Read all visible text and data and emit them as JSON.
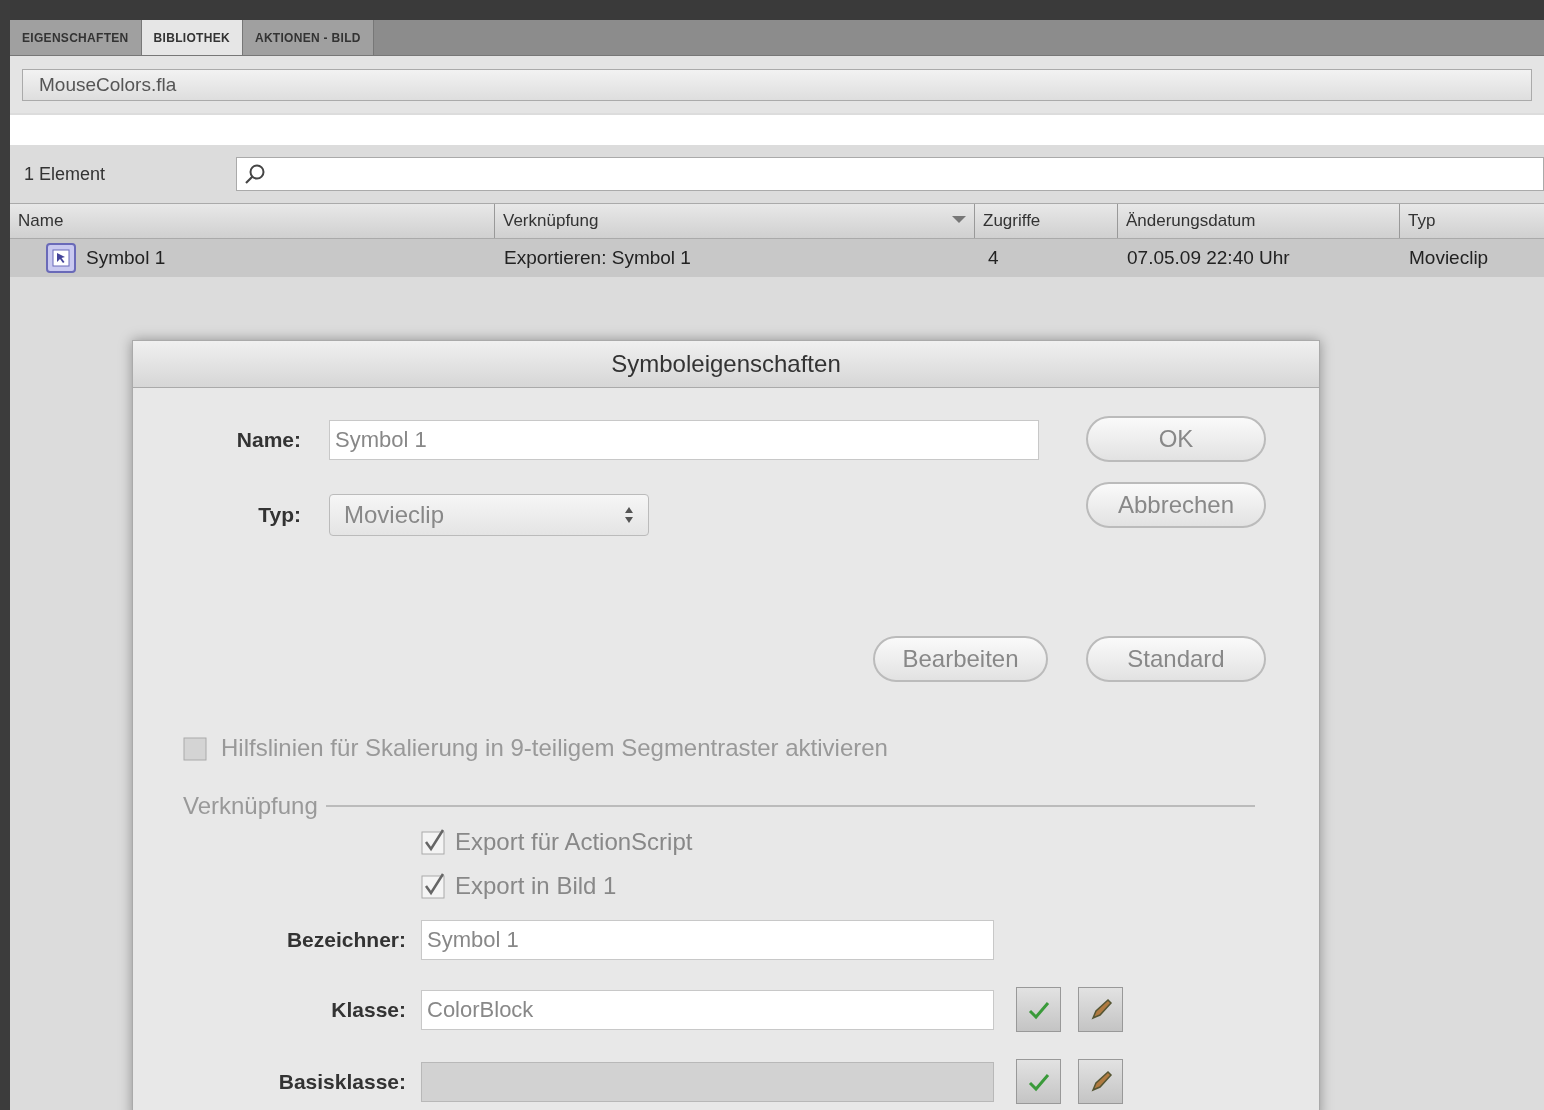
{
  "tabs": [
    {
      "label": "EIGENSCHAFTEN",
      "selected": false
    },
    {
      "label": "BIBLIOTHEK",
      "selected": true
    },
    {
      "label": "AKTIONEN - BILD",
      "selected": false
    }
  ],
  "library": {
    "file": "MouseColors.fla",
    "count": "1 Element",
    "columns": [
      {
        "label": "Name",
        "sorted": false
      },
      {
        "label": "Verknüpfung",
        "sorted": true
      },
      {
        "label": "Zugriffe",
        "sorted": false
      },
      {
        "label": "Änderungsdatum",
        "sorted": false
      },
      {
        "label": "Typ",
        "sorted": false
      }
    ],
    "rows": [
      {
        "name": "Symbol 1",
        "linkage": "Exportieren: Symbol 1",
        "uses": "4",
        "modified": "07.05.09 22:40 Uhr",
        "type": "Movieclip",
        "selected": true
      }
    ]
  },
  "dialog": {
    "title": "Symboleigenschaften",
    "name_label": "Name:",
    "name_value": "Symbol 1",
    "type_label": "Typ:",
    "type_value": "Movieclip",
    "buttons": [
      "OK",
      "Abbrechen"
    ],
    "edit_buttons": [
      "Bearbeiten",
      "Standard"
    ],
    "scale_guides": {
      "label": "Hilfslinien für Skalierung in 9-teiligem Segmentraster aktivieren",
      "checked": false,
      "disabled": true
    },
    "linkage_legend": "Verknüpfung",
    "linkage_options": [
      {
        "label": "Export für ActionScript",
        "checked": true
      },
      {
        "label": "Export in Bild 1",
        "checked": true
      }
    ],
    "fields": [
      {
        "label": "Bezeichner:",
        "value": "Symbol 1",
        "disabled": false
      },
      {
        "label": "Klasse:",
        "value": "ColorBlock",
        "disabled": false,
        "tools": true
      },
      {
        "label": "Basisklasse:",
        "disabled": true,
        "tools": true
      }
    ]
  }
}
